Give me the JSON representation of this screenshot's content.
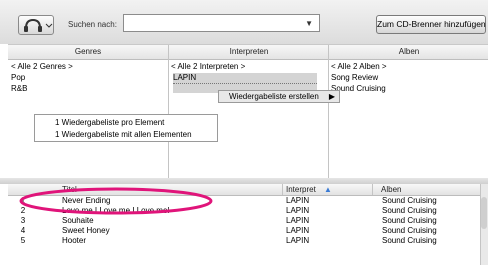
{
  "toolbar": {
    "search_label": "Suchen nach:",
    "search_value": "",
    "burn_button": "Zum CD-Brenner hinzufügen"
  },
  "browser": {
    "headers": {
      "genres": "Genres",
      "artists": "Interpreten",
      "albums": "Alben"
    },
    "genres": [
      "< Alle 2 Genres >",
      "Pop",
      "R&B"
    ],
    "artists": [
      "< Alle 2 Interpreten >",
      "LAPIN"
    ],
    "albums": [
      "< Alle 2 Alben >",
      "Song Review",
      "Sound Cruising"
    ]
  },
  "context_menu": {
    "item": "Wiedergabeliste erstellen",
    "submenu": [
      "1 Wiedergabeliste pro Element",
      "1 Wiedergabeliste mit allen Elementen"
    ]
  },
  "table": {
    "headers": {
      "title": "Titel",
      "artist": "Interpret",
      "album": "Alben"
    },
    "rows": [
      {
        "num": "1",
        "title": "Never Ending",
        "artist": "LAPIN",
        "album": "Sound Cruising"
      },
      {
        "num": "2",
        "title": "Love me I Love me I Love me!",
        "artist": "LAPIN",
        "album": "Sound Cruising"
      },
      {
        "num": "3",
        "title": "Souhaite",
        "artist": "LAPIN",
        "album": "Sound Cruising"
      },
      {
        "num": "4",
        "title": "Sweet Honey",
        "artist": "LAPIN",
        "album": "Sound Cruising"
      },
      {
        "num": "5",
        "title": "Hooter",
        "artist": "LAPIN",
        "album": "Sound Cruising"
      }
    ]
  },
  "colors": {
    "highlight_circle": "#e0147a",
    "sort_arrow": "#3a7bd5"
  }
}
